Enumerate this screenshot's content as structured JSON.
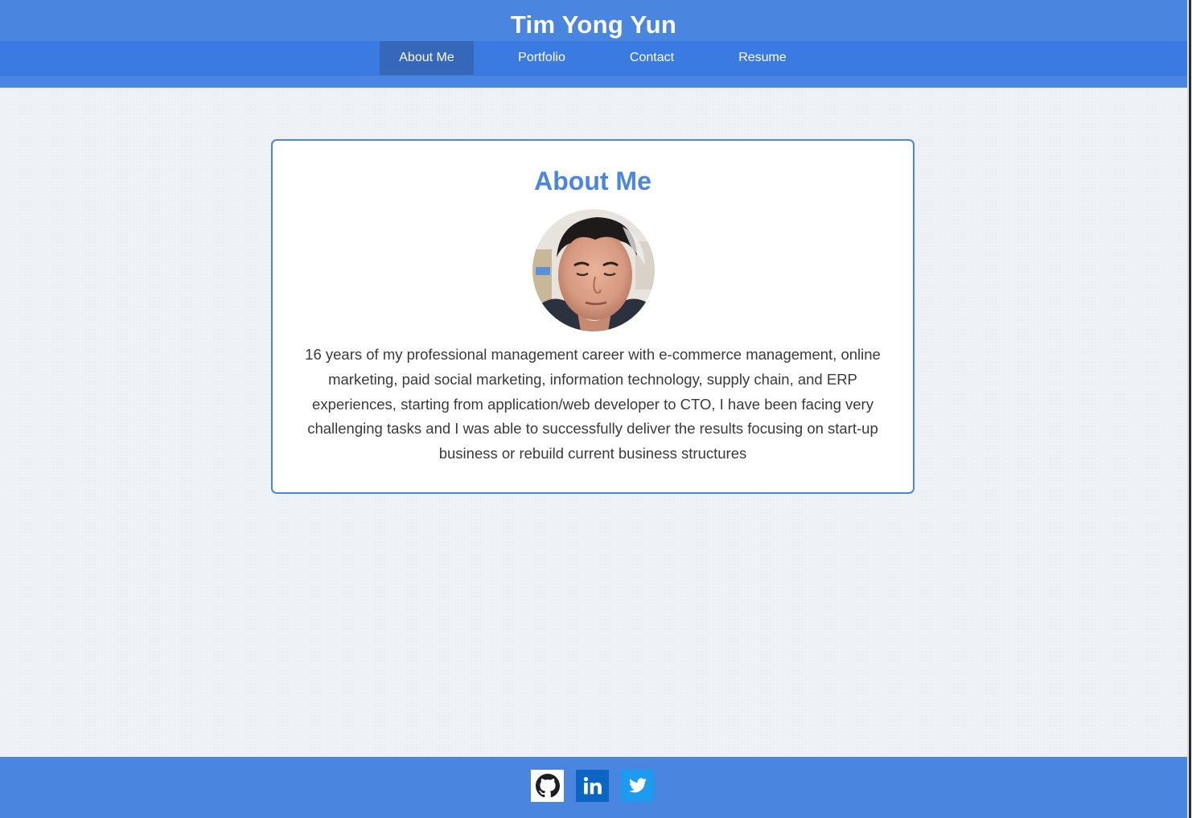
{
  "header": {
    "title": "Tim Yong Yun",
    "nav": [
      {
        "label": "About Me",
        "active": true
      },
      {
        "label": "Portfolio",
        "active": false
      },
      {
        "label": "Contact",
        "active": false
      },
      {
        "label": "Resume",
        "active": false
      }
    ]
  },
  "about": {
    "heading": "About Me",
    "avatar_icon": "profile-photo",
    "bio": "16 years of my professional management career with e-commerce management, online marketing, paid social marketing, information technology, supply chain, and ERP experiences, starting from application/web developer to CTO, I have been facing very challenging tasks and I was able to successfully deliver the results focusing on start-up business or rebuild current business structures"
  },
  "footer": {
    "social": [
      {
        "name": "GitHub",
        "icon": "github-icon"
      },
      {
        "name": "LinkedIn",
        "icon": "linkedin-icon"
      },
      {
        "name": "Twitter",
        "icon": "twitter-icon"
      }
    ]
  },
  "colors": {
    "primary": "#4a86e0",
    "nav_bar": "#3b7ae0",
    "nav_active": "#3568b8",
    "background": "#eef1f5",
    "text": "#3a3a3a"
  }
}
